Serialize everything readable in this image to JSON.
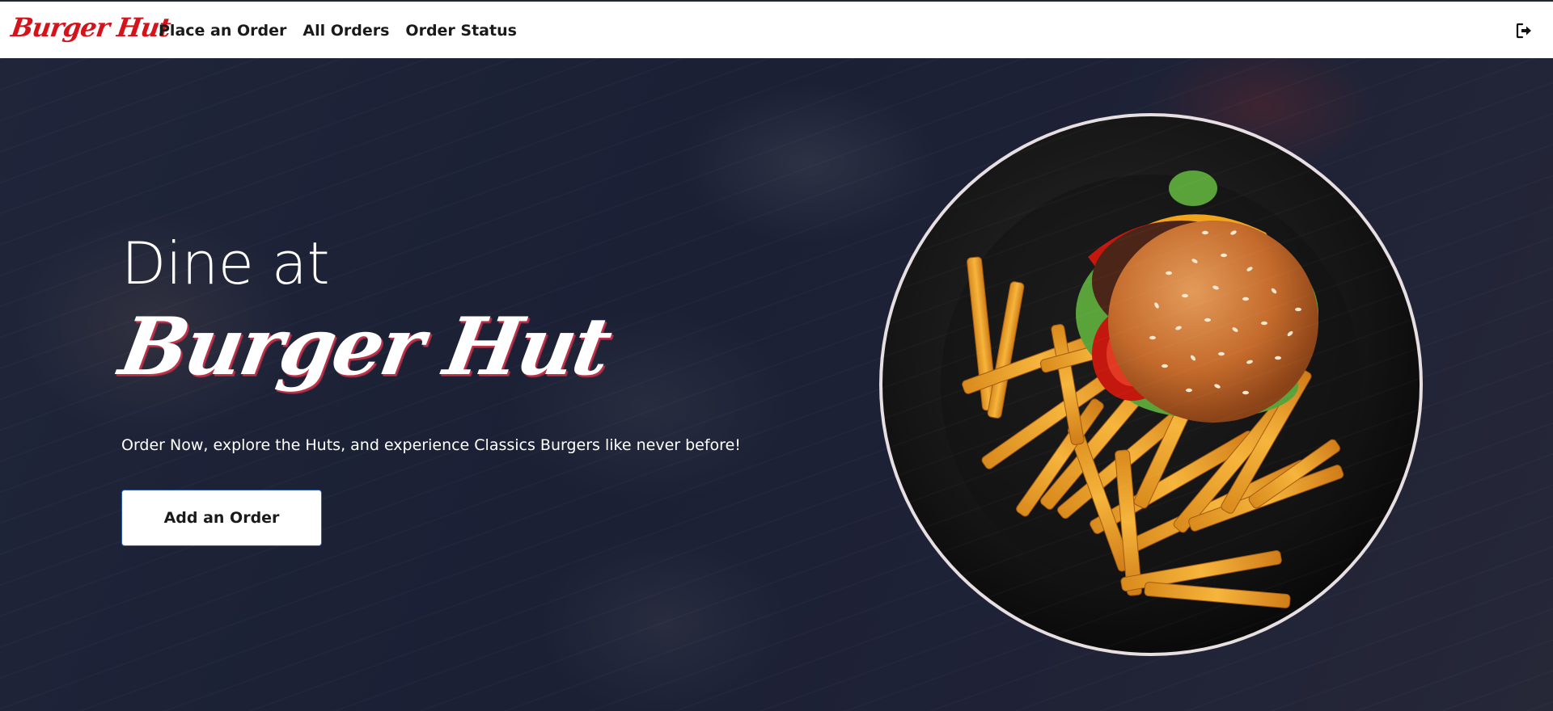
{
  "navbar": {
    "logo": "Burger Hut",
    "links": [
      "Place an Order",
      "All Orders",
      "Order Status"
    ],
    "logout_icon": "logout-icon"
  },
  "hero": {
    "eyebrow": "Dine at",
    "brand": "Burger Hut",
    "tagline": "Order Now, explore the Huts, and experience Classics Burgers like never before!",
    "cta_label": "Add an Order",
    "image": "burger-and-fries-plate"
  },
  "colors": {
    "brand_red": "#d4131b",
    "hero_bg": "#1b1f33",
    "navbar_bg": "#ffffff",
    "cta_border": "#2a5db0"
  }
}
